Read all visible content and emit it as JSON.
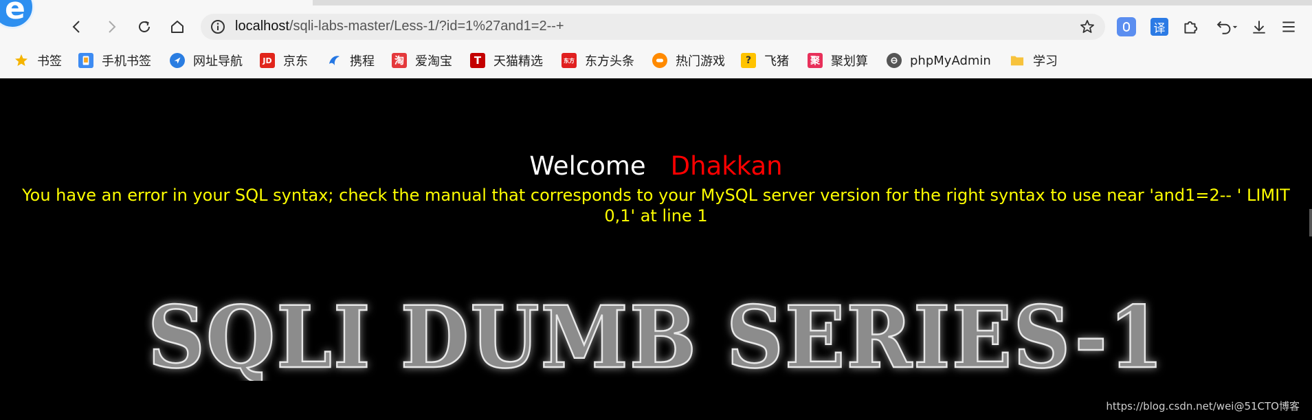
{
  "browser": {
    "url_host": "localhost",
    "url_path": "/sqli-labs-master/Less-1/?id=1%27and1=2--+",
    "extension_1_label": "",
    "translate_label": "译"
  },
  "bookmarks": [
    {
      "label": "书签",
      "icon": "star-icon",
      "color": "#f5b400"
    },
    {
      "label": "手机书签",
      "icon": "phone-icon",
      "color": "#3d8bf2"
    },
    {
      "label": "网址导航",
      "icon": "navigation-icon",
      "color": "#2a7de1"
    },
    {
      "label": "京东",
      "icon": "jd-icon",
      "color": "#e1251b",
      "glyph": "JD"
    },
    {
      "label": "携程",
      "icon": "ctrip-icon",
      "color": "#2577e3"
    },
    {
      "label": "爱淘宝",
      "icon": "taobao-icon",
      "color": "#e4393c",
      "glyph": "淘"
    },
    {
      "label": "天猫精选",
      "icon": "tmall-icon",
      "color": "#c40000",
      "glyph": "T"
    },
    {
      "label": "东方头条",
      "icon": "toutiao-icon",
      "color": "#e02020",
      "glyph": "东方"
    },
    {
      "label": "热门游戏",
      "icon": "game-icon",
      "color": "#ff8a00"
    },
    {
      "label": "飞猪",
      "icon": "fliggy-icon",
      "color": "#ffc300",
      "glyph": "?"
    },
    {
      "label": "聚划算",
      "icon": "juhuasuan-icon",
      "color": "#e8305a",
      "glyph": "聚"
    },
    {
      "label": "phpMyAdmin",
      "icon": "phpmyadmin-icon",
      "color": "#555555"
    },
    {
      "label": "学习",
      "icon": "folder-icon",
      "color": "#f7c23c"
    }
  ],
  "page": {
    "welcome": "Welcome",
    "username": "Dhakkan",
    "sql_error": "You have an error in your SQL syntax; check the manual that corresponds to your MySQL server version for the right syntax to use near 'and1=2-- ' LIMIT 0,1' at line 1",
    "banner": "SQLI DUMB SERIES-1"
  },
  "watermark": "https://blog.csdn.net/wei@51CTO博客",
  "colors": {
    "page_background": "#000000",
    "welcome": "#ffffff",
    "username": "#ff0000",
    "sql_error": "#ffff00"
  }
}
